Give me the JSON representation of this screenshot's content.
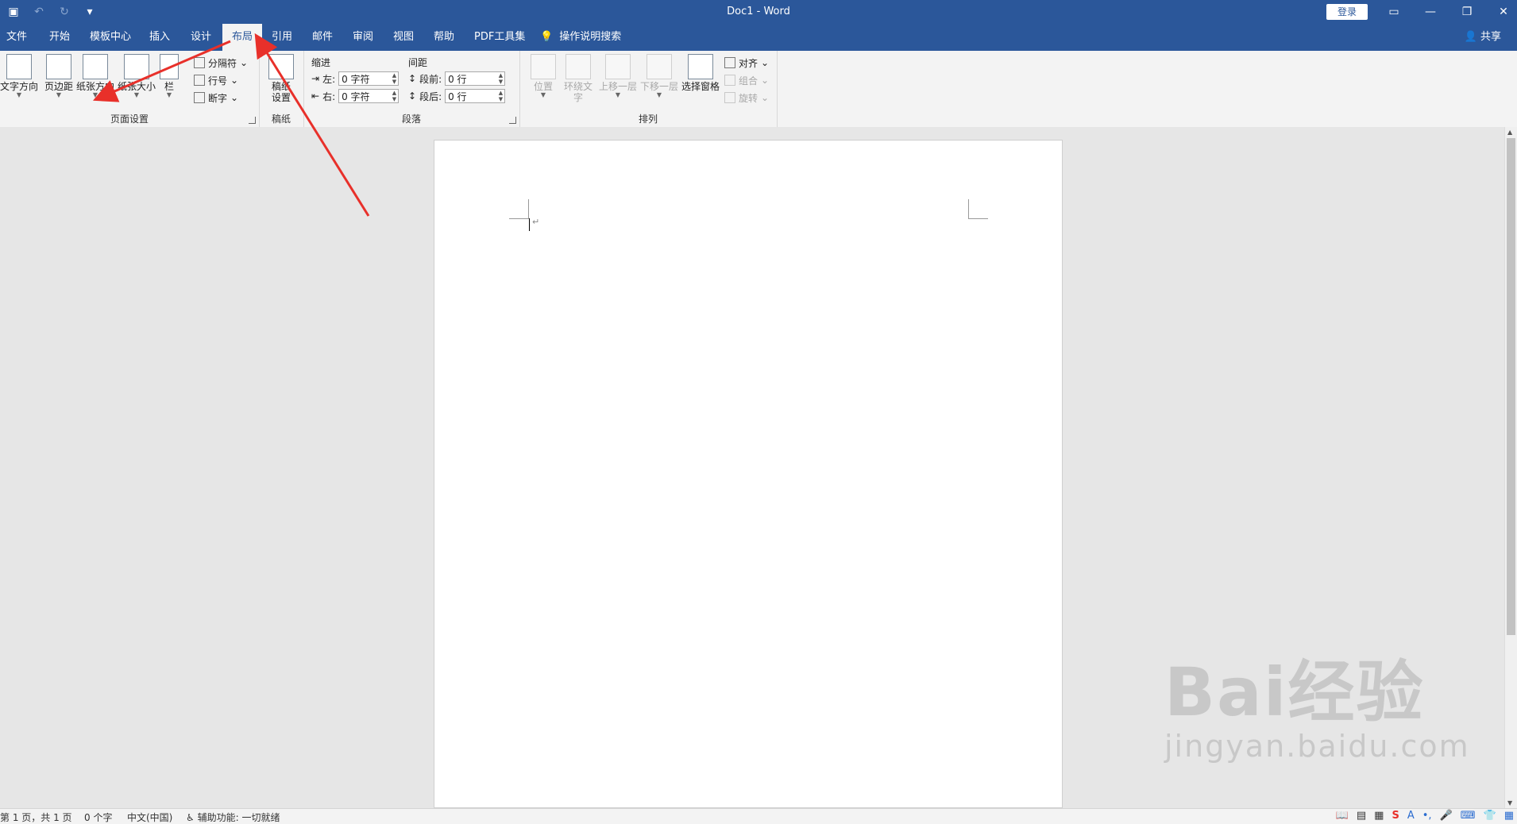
{
  "window": {
    "doc_title": "Doc1  -  Word",
    "login_label": "登录"
  },
  "tabs": [
    {
      "label": "文件",
      "active": false
    },
    {
      "label": "开始",
      "active": false
    },
    {
      "label": "模板中心",
      "active": false
    },
    {
      "label": "插入",
      "active": false
    },
    {
      "label": "设计",
      "active": false
    },
    {
      "label": "布局",
      "active": true
    },
    {
      "label": "引用",
      "active": false
    },
    {
      "label": "邮件",
      "active": false
    },
    {
      "label": "审阅",
      "active": false
    },
    {
      "label": "视图",
      "active": false
    },
    {
      "label": "帮助",
      "active": false
    },
    {
      "label": "PDF工具集",
      "active": false
    }
  ],
  "search_tab": "操作说明搜索",
  "share_label": "共享",
  "ribbon": {
    "page_setup": {
      "label": "页面设置",
      "text_direction": "文字方向",
      "margins": "页边距",
      "orientation": "纸张方向",
      "size": "纸张大小",
      "columns": "栏",
      "breaks": "分隔符",
      "line_numbers": "行号",
      "hyphenation": "断字"
    },
    "manuscript": {
      "label": "稿纸",
      "setup": "稿纸设置"
    },
    "paragraph": {
      "label": "段落",
      "indent_title": "缩进",
      "spacing_title": "间距",
      "left_label": "左:",
      "right_label": "右:",
      "before_label": "段前:",
      "after_label": "段后:",
      "left_value": "0 字符",
      "right_value": "0 字符",
      "before_value": "0 行",
      "after_value": "0 行"
    },
    "arrange": {
      "label": "排列",
      "position": "位置",
      "wrap_text": "环绕文字",
      "bring_forward": "上移一层",
      "send_backward": "下移一层",
      "selection_pane": "选择窗格",
      "align": "对齐",
      "group": "组合",
      "rotate": "旋转"
    }
  },
  "status": {
    "page": "第 1 页，共 1 页",
    "words": "0 个字",
    "language": "中文(中国)",
    "accessibility": "辅助功能: 一切就绪"
  },
  "watermark": {
    "main": "Bai经验",
    "sub": "jingyan.baidu.com"
  },
  "annotation_color": "#e8302a"
}
